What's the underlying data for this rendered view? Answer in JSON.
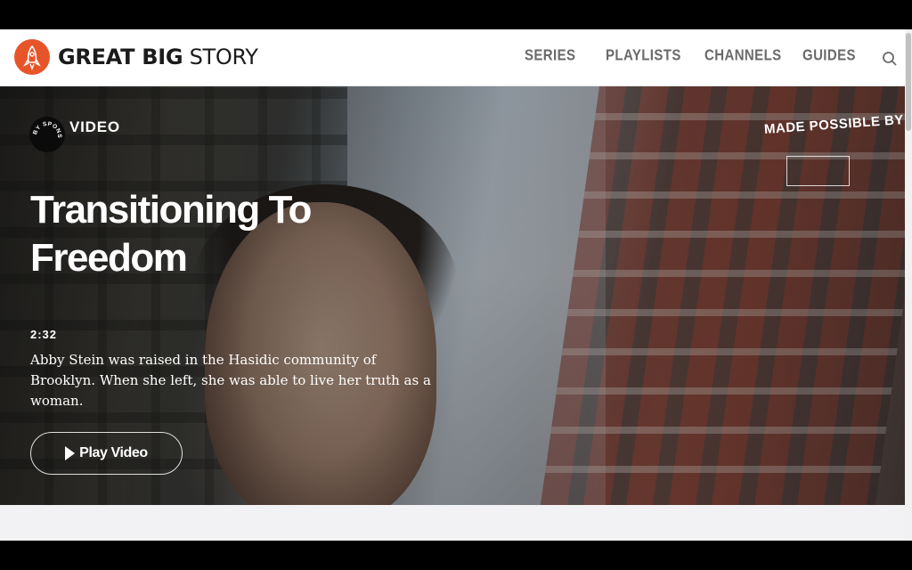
{
  "brand": {
    "bold": "GREAT BIG",
    "light": "STORY",
    "accent": "#e8542a"
  },
  "nav": {
    "items": [
      "SERIES",
      "PLAYLISTS",
      "CHANNELS",
      "GUIDES"
    ]
  },
  "hero": {
    "sponsor_badge_text": "BY SPONSOR",
    "type_label": "VIDEO",
    "title": "Transitioning To Freedom",
    "duration": "2:32",
    "description": "Abby Stein was raised in the Hasidic community of Brooklyn. When she left, she was able to live her truth as a woman.",
    "play_label": "Play Video",
    "made_possible": "MADE POSSIBLE BY"
  },
  "icons": {
    "search": "search-icon",
    "play": "play-icon",
    "logo": "rocket-logo-icon"
  }
}
